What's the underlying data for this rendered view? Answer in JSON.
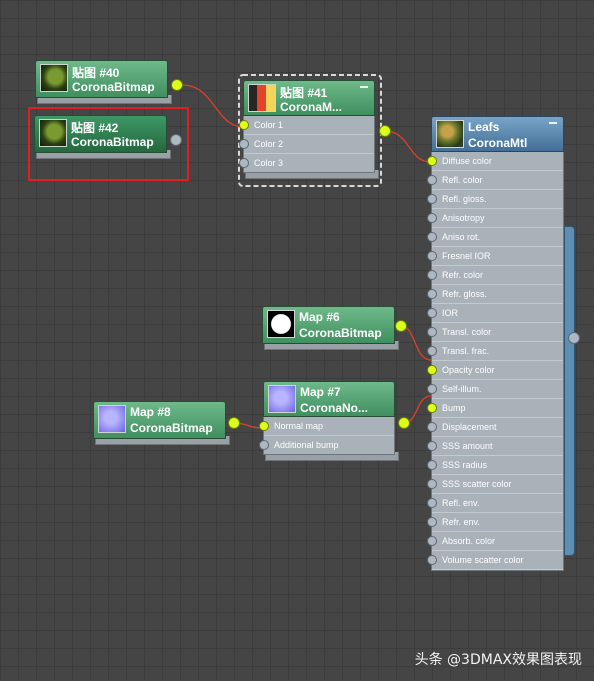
{
  "nodes": {
    "map40": {
      "title": "贴图 #40",
      "subtitle": "CoronaBitmap"
    },
    "map42": {
      "title": "贴图 #42",
      "subtitle": "CoronaBitmap"
    },
    "map41": {
      "title": "贴图 #41",
      "subtitle": "CoronaM...",
      "slots": [
        "Color 1",
        "Color 2",
        "Color 3"
      ]
    },
    "leafs": {
      "title": "Leafs",
      "subtitle": "CoronaMtl",
      "slots": [
        "Diffuse color",
        "Refl. color",
        "Refl. gloss.",
        "Anisotropy",
        "Aniso rot.",
        "Fresnel IOR",
        "Refr. color",
        "Refr. gloss.",
        "IOR",
        "Transl. color",
        "Transl. frac.",
        "Opacity color",
        "Self-illum.",
        "Bump",
        "Displacement",
        "SSS amount",
        "SSS radius",
        "SSS scatter color",
        "Refl. env.",
        "Refr. env.",
        "Absorb. color",
        "Volume scatter color"
      ]
    },
    "map6": {
      "title": "Map #6",
      "subtitle": "CoronaBitmap"
    },
    "map7": {
      "title": "Map #7",
      "subtitle": "CoronaNo...",
      "slots": [
        "Normal map",
        "Additional bump"
      ]
    },
    "map8": {
      "title": "Map #8",
      "subtitle": "CoronaBitmap"
    }
  },
  "watermark": "头条 @3DMAX效果图表现",
  "colors": {
    "node_header": "#4fa371",
    "material_header": "#5b87b0",
    "connected_port": "#dcff1a",
    "wire": "#e0402a",
    "highlight_box": "#e02020"
  }
}
